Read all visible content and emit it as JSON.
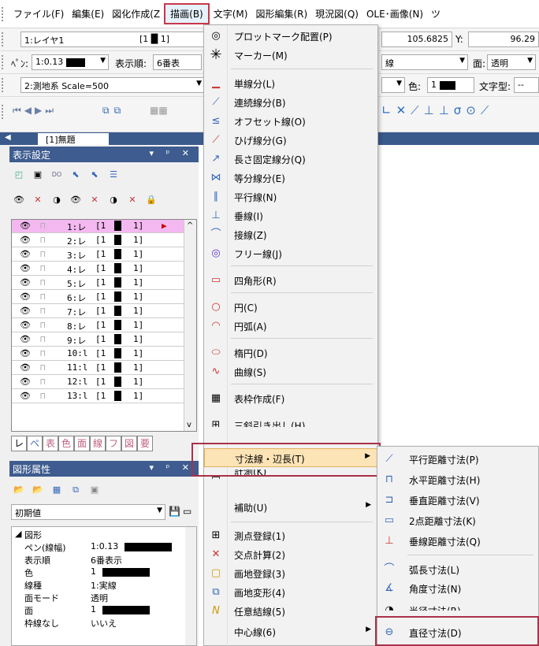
{
  "menubar": {
    "items": [
      "ファイル(F)",
      "編集(E)",
      "図化作成(Z",
      "描画(B)",
      "文字(M)",
      "図形編集(R)",
      "現況図(Q)",
      "OLE･画像(N)",
      "ツ"
    ]
  },
  "toolbar1": {
    "layer": "1:レイヤ1",
    "layer_val": "[1 █ 1]",
    "x_value": "105.6825",
    "y_label": "Y:",
    "y_value": "96.29"
  },
  "toolbar2": {
    "pen_label": "ﾍﾟﾝ:",
    "pen_value": "1:0.13",
    "order_label": "表示順:",
    "order_value": "6番表",
    "line_value": "線",
    "face_label": "面:",
    "face_value": "透明"
  },
  "toolbar3": {
    "coord_system": "2:測地系 Scale=500",
    "color_label": "色:",
    "color_value": "1",
    "font_label": "文字型:",
    "font_value": "--"
  },
  "doc_tab": {
    "label": "[1]無題"
  },
  "display_panel": {
    "title": "表示設定"
  },
  "layers": [
    {
      "label": "1:レ",
      "bracket": "[1",
      "end": "1]"
    },
    {
      "label": "2:レ",
      "bracket": "[1",
      "end": "1]"
    },
    {
      "label": "3:レ",
      "bracket": "[1",
      "end": "1]"
    },
    {
      "label": "4:レ",
      "bracket": "[1",
      "end": "1]"
    },
    {
      "label": "5:レ",
      "bracket": "[1",
      "end": "1]"
    },
    {
      "label": "6:レ",
      "bracket": "[1",
      "end": "1]"
    },
    {
      "label": "7:レ",
      "bracket": "[1",
      "end": "1]"
    },
    {
      "label": "8:レ",
      "bracket": "[1",
      "end": "1]"
    },
    {
      "label": "9:レ",
      "bracket": "[1",
      "end": "1]"
    },
    {
      "label": "10:l",
      "bracket": "[1",
      "end": "1]"
    },
    {
      "label": "11:l",
      "bracket": "[1",
      "end": "1]"
    },
    {
      "label": "12:l",
      "bracket": "[1",
      "end": "1]"
    },
    {
      "label": "13:l",
      "bracket": "[1",
      "end": "1]"
    }
  ],
  "bottom_tabs": [
    "レ",
    "ペ",
    "表",
    "色",
    "面",
    "線",
    "フ",
    "図",
    "要"
  ],
  "attr_panel": {
    "title": "図形属性",
    "preset": "初期値",
    "group": "図形",
    "rows": [
      {
        "key": "ペン(線幅)",
        "value": "1:0.13"
      },
      {
        "key": "表示順",
        "value": "6番表示"
      },
      {
        "key": "色",
        "value": "1"
      },
      {
        "key": "線種",
        "value": "1:実線"
      },
      {
        "key": "面モード",
        "value": "透明"
      },
      {
        "key": "面",
        "value": "1"
      },
      {
        "key": "枠線なし",
        "value": "いいえ"
      }
    ]
  },
  "draw_menu": {
    "items": [
      {
        "label": "プロットマーク配置(P)",
        "icon": "◎"
      },
      {
        "label": "マーカー(M)",
        "icon": "✳"
      },
      {
        "label": "単線分(L)",
        "icon": "▁"
      },
      {
        "label": "連続線分(B)",
        "icon": "⟋"
      },
      {
        "label": "オフセット線(O)",
        "icon": "≤"
      },
      {
        "label": "ひげ線分(G)",
        "icon": "⟋"
      },
      {
        "label": "長さ固定線分(Q)",
        "icon": "↗"
      },
      {
        "label": "等分線分(E)",
        "icon": "⋈"
      },
      {
        "label": "平行線(N)",
        "icon": "∥"
      },
      {
        "label": "垂線(I)",
        "icon": "⊥"
      },
      {
        "label": "接線(Z)",
        "icon": "⌒"
      },
      {
        "label": "フリー線(J)",
        "icon": "◎"
      },
      {
        "label": "四角形(R)",
        "icon": "▭"
      },
      {
        "label": "円(C)",
        "icon": "○"
      },
      {
        "label": "円弧(A)",
        "icon": "◠"
      },
      {
        "label": "楕円(D)",
        "icon": "⬭"
      },
      {
        "label": "曲線(S)",
        "icon": "∿"
      },
      {
        "label": "表枠作成(F)",
        "icon": "▦"
      },
      {
        "label": "三斜引き出し(H)",
        "icon": "⊞"
      },
      {
        "label": "寸法線・辺長(T)",
        "icon": ""
      },
      {
        "label": "計測(K)",
        "icon": "▭"
      },
      {
        "label": "補助(U)",
        "icon": ""
      },
      {
        "label": "測点登録(1)",
        "icon": "⊞"
      },
      {
        "label": "交点計算(2)",
        "icon": "✕"
      },
      {
        "label": "画地登録(3)",
        "icon": "▢"
      },
      {
        "label": "画地変形(4)",
        "icon": "⧉"
      },
      {
        "label": "任意結線(5)",
        "icon": "N"
      },
      {
        "label": "中心線(6)",
        "icon": ""
      }
    ]
  },
  "dim_submenu": {
    "items": [
      {
        "label": "平行距離寸法(P)",
        "icon": "⟋"
      },
      {
        "label": "水平距離寸法(H)",
        "icon": "⊓"
      },
      {
        "label": "垂直距離寸法(V)",
        "icon": "⊐"
      },
      {
        "label": "2点距離寸法(K)",
        "icon": "▭"
      },
      {
        "label": "垂線距離寸法(Q)",
        "icon": "⊥"
      },
      {
        "label": "弧長寸法(L)",
        "icon": "⌒"
      },
      {
        "label": "角度寸法(N)",
        "icon": "∡"
      },
      {
        "label": "半径寸法(R)",
        "icon": "◔"
      },
      {
        "label": "直径寸法(D)",
        "icon": "⊖"
      }
    ]
  }
}
